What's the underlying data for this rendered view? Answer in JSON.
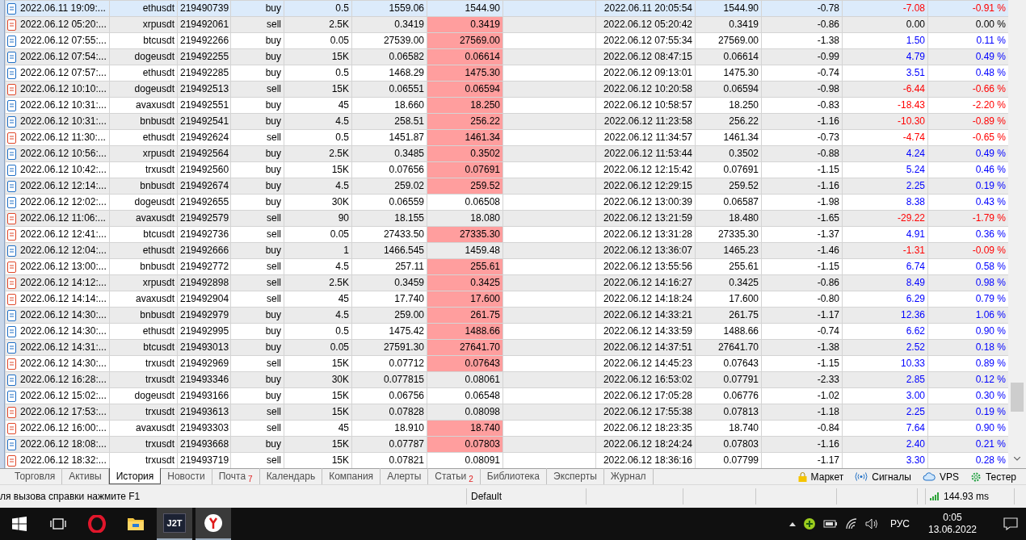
{
  "rows": [
    {
      "cells": [
        "2022.06.11 19:09:...",
        "ethusdt",
        "219490739",
        "buy",
        "0.5",
        "1559.06",
        "1544.90",
        "2022.06.11 20:05:54",
        "1544.90",
        "-0.78",
        "-7.08",
        "-0.91 %"
      ],
      "selected": true,
      "kind": "buy",
      "highlighted": false,
      "loss": true,
      "profit": false
    },
    {
      "cells": [
        "2022.06.12 05:20:...",
        "xrpusdt",
        "219492061",
        "sell",
        "2.5K",
        "0.3419",
        "0.3419",
        "2022.06.12 05:20:42",
        "0.3419",
        "-0.86",
        "0.00",
        "0.00 %"
      ],
      "selected": false,
      "kind": "sell",
      "highlighted": true,
      "loss": false,
      "profit": false
    },
    {
      "cells": [
        "2022.06.12 07:55:...",
        "btcusdt",
        "219492266",
        "buy",
        "0.05",
        "27539.00",
        "27569.00",
        "2022.06.12 07:55:34",
        "27569.00",
        "-1.38",
        "1.50",
        "0.11 %"
      ],
      "selected": false,
      "kind": "buy",
      "highlighted": true,
      "loss": false,
      "profit": true
    },
    {
      "cells": [
        "2022.06.12 07:54:...",
        "dogeusdt",
        "219492255",
        "buy",
        "15K",
        "0.06582",
        "0.06614",
        "2022.06.12 08:47:15",
        "0.06614",
        "-0.99",
        "4.79",
        "0.49 %"
      ],
      "selected": false,
      "kind": "buy",
      "highlighted": true,
      "loss": false,
      "profit": true
    },
    {
      "cells": [
        "2022.06.12 07:57:...",
        "ethusdt",
        "219492285",
        "buy",
        "0.5",
        "1468.29",
        "1475.30",
        "2022.06.12 09:13:01",
        "1475.30",
        "-0.74",
        "3.51",
        "0.48 %"
      ],
      "selected": false,
      "kind": "buy",
      "highlighted": true,
      "loss": false,
      "profit": true
    },
    {
      "cells": [
        "2022.06.12 10:10:...",
        "dogeusdt",
        "219492513",
        "sell",
        "15K",
        "0.06551",
        "0.06594",
        "2022.06.12 10:20:58",
        "0.06594",
        "-0.98",
        "-6.44",
        "-0.66 %"
      ],
      "selected": false,
      "kind": "sell",
      "highlighted": true,
      "loss": true,
      "profit": false
    },
    {
      "cells": [
        "2022.06.12 10:31:...",
        "avaxusdt",
        "219492551",
        "buy",
        "45",
        "18.660",
        "18.250",
        "2022.06.12 10:58:57",
        "18.250",
        "-0.83",
        "-18.43",
        "-2.20 %"
      ],
      "selected": false,
      "kind": "buy",
      "highlighted": true,
      "loss": true,
      "profit": false
    },
    {
      "cells": [
        "2022.06.12 10:31:...",
        "bnbusdt",
        "219492541",
        "buy",
        "4.5",
        "258.51",
        "256.22",
        "2022.06.12 11:23:58",
        "256.22",
        "-1.16",
        "-10.30",
        "-0.89 %"
      ],
      "selected": false,
      "kind": "buy",
      "highlighted": true,
      "loss": true,
      "profit": false
    },
    {
      "cells": [
        "2022.06.12 11:30:...",
        "ethusdt",
        "219492624",
        "sell",
        "0.5",
        "1451.87",
        "1461.34",
        "2022.06.12 11:34:57",
        "1461.34",
        "-0.73",
        "-4.74",
        "-0.65 %"
      ],
      "selected": false,
      "kind": "sell",
      "highlighted": true,
      "loss": true,
      "profit": false
    },
    {
      "cells": [
        "2022.06.12 10:56:...",
        "xrpusdt",
        "219492564",
        "buy",
        "2.5K",
        "0.3485",
        "0.3502",
        "2022.06.12 11:53:44",
        "0.3502",
        "-0.88",
        "4.24",
        "0.49 %"
      ],
      "selected": false,
      "kind": "buy",
      "highlighted": true,
      "loss": false,
      "profit": true
    },
    {
      "cells": [
        "2022.06.12 10:42:...",
        "trxusdt",
        "219492560",
        "buy",
        "15K",
        "0.07656",
        "0.07691",
        "2022.06.12 12:15:42",
        "0.07691",
        "-1.15",
        "5.24",
        "0.46 %"
      ],
      "selected": false,
      "kind": "buy",
      "highlighted": true,
      "loss": false,
      "profit": true
    },
    {
      "cells": [
        "2022.06.12 12:14:...",
        "bnbusdt",
        "219492674",
        "buy",
        "4.5",
        "259.02",
        "259.52",
        "2022.06.12 12:29:15",
        "259.52",
        "-1.16",
        "2.25",
        "0.19 %"
      ],
      "selected": false,
      "kind": "buy",
      "highlighted": true,
      "loss": false,
      "profit": true
    },
    {
      "cells": [
        "2022.06.12 12:02:...",
        "dogeusdt",
        "219492655",
        "buy",
        "30K",
        "0.06559",
        "0.06508",
        "2022.06.12 13:00:39",
        "0.06587",
        "-1.98",
        "8.38",
        "0.43 %"
      ],
      "selected": false,
      "kind": "buy",
      "highlighted": false,
      "loss": false,
      "profit": true
    },
    {
      "cells": [
        "2022.06.12 11:06:...",
        "avaxusdt",
        "219492579",
        "sell",
        "90",
        "18.155",
        "18.080",
        "2022.06.12 13:21:59",
        "18.480",
        "-1.65",
        "-29.22",
        "-1.79 %"
      ],
      "selected": false,
      "kind": "sell",
      "highlighted": false,
      "loss": true,
      "profit": false
    },
    {
      "cells": [
        "2022.06.12 12:41:...",
        "btcusdt",
        "219492736",
        "sell",
        "0.05",
        "27433.50",
        "27335.30",
        "2022.06.12 13:31:28",
        "27335.30",
        "-1.37",
        "4.91",
        "0.36 %"
      ],
      "selected": false,
      "kind": "sell",
      "highlighted": true,
      "loss": false,
      "profit": true
    },
    {
      "cells": [
        "2022.06.12 12:04:...",
        "ethusdt",
        "219492666",
        "buy",
        "1",
        "1466.545",
        "1459.48",
        "2022.06.12 13:36:07",
        "1465.23",
        "-1.46",
        "-1.31",
        "-0.09 %"
      ],
      "selected": false,
      "kind": "buy",
      "highlighted": false,
      "loss": true,
      "profit": false
    },
    {
      "cells": [
        "2022.06.12 13:00:...",
        "bnbusdt",
        "219492772",
        "sell",
        "4.5",
        "257.11",
        "255.61",
        "2022.06.12 13:55:56",
        "255.61",
        "-1.15",
        "6.74",
        "0.58 %"
      ],
      "selected": false,
      "kind": "sell",
      "highlighted": true,
      "loss": false,
      "profit": true
    },
    {
      "cells": [
        "2022.06.12 14:12:...",
        "xrpusdt",
        "219492898",
        "sell",
        "2.5K",
        "0.3459",
        "0.3425",
        "2022.06.12 14:16:27",
        "0.3425",
        "-0.86",
        "8.49",
        "0.98 %"
      ],
      "selected": false,
      "kind": "sell",
      "highlighted": true,
      "loss": false,
      "profit": true
    },
    {
      "cells": [
        "2022.06.12 14:14:...",
        "avaxusdt",
        "219492904",
        "sell",
        "45",
        "17.740",
        "17.600",
        "2022.06.12 14:18:24",
        "17.600",
        "-0.80",
        "6.29",
        "0.79 %"
      ],
      "selected": false,
      "kind": "sell",
      "highlighted": true,
      "loss": false,
      "profit": true
    },
    {
      "cells": [
        "2022.06.12 14:30:...",
        "bnbusdt",
        "219492979",
        "buy",
        "4.5",
        "259.00",
        "261.75",
        "2022.06.12 14:33:21",
        "261.75",
        "-1.17",
        "12.36",
        "1.06 %"
      ],
      "selected": false,
      "kind": "buy",
      "highlighted": true,
      "loss": false,
      "profit": true
    },
    {
      "cells": [
        "2022.06.12 14:30:...",
        "ethusdt",
        "219492995",
        "buy",
        "0.5",
        "1475.42",
        "1488.66",
        "2022.06.12 14:33:59",
        "1488.66",
        "-0.74",
        "6.62",
        "0.90 %"
      ],
      "selected": false,
      "kind": "buy",
      "highlighted": true,
      "loss": false,
      "profit": true
    },
    {
      "cells": [
        "2022.06.12 14:31:...",
        "btcusdt",
        "219493013",
        "buy",
        "0.05",
        "27591.30",
        "27641.70",
        "2022.06.12 14:37:51",
        "27641.70",
        "-1.38",
        "2.52",
        "0.18 %"
      ],
      "selected": false,
      "kind": "buy",
      "highlighted": true,
      "loss": false,
      "profit": true
    },
    {
      "cells": [
        "2022.06.12 14:30:...",
        "trxusdt",
        "219492969",
        "sell",
        "15K",
        "0.07712",
        "0.07643",
        "2022.06.12 14:45:23",
        "0.07643",
        "-1.15",
        "10.33",
        "0.89 %"
      ],
      "selected": false,
      "kind": "sell",
      "highlighted": true,
      "loss": false,
      "profit": true
    },
    {
      "cells": [
        "2022.06.12 16:28:...",
        "trxusdt",
        "219493346",
        "buy",
        "30K",
        "0.077815",
        "0.08061",
        "2022.06.12 16:53:02",
        "0.07791",
        "-2.33",
        "2.85",
        "0.12 %"
      ],
      "selected": false,
      "kind": "buy",
      "highlighted": false,
      "loss": false,
      "profit": true
    },
    {
      "cells": [
        "2022.06.12 15:02:...",
        "dogeusdt",
        "219493166",
        "buy",
        "15K",
        "0.06756",
        "0.06548",
        "2022.06.12 17:05:28",
        "0.06776",
        "-1.02",
        "3.00",
        "0.30 %"
      ],
      "selected": false,
      "kind": "buy",
      "highlighted": false,
      "loss": false,
      "profit": true
    },
    {
      "cells": [
        "2022.06.12 17:53:...",
        "trxusdt",
        "219493613",
        "sell",
        "15K",
        "0.07828",
        "0.08098",
        "2022.06.12 17:55:38",
        "0.07813",
        "-1.18",
        "2.25",
        "0.19 %"
      ],
      "selected": false,
      "kind": "sell",
      "highlighted": false,
      "loss": false,
      "profit": true
    },
    {
      "cells": [
        "2022.06.12 16:00:...",
        "avaxusdt",
        "219493303",
        "sell",
        "45",
        "18.910",
        "18.740",
        "2022.06.12 18:23:35",
        "18.740",
        "-0.84",
        "7.64",
        "0.90 %"
      ],
      "selected": false,
      "kind": "sell",
      "highlighted": true,
      "loss": false,
      "profit": true
    },
    {
      "cells": [
        "2022.06.12 18:08:...",
        "trxusdt",
        "219493668",
        "buy",
        "15K",
        "0.07787",
        "0.07803",
        "2022.06.12 18:24:24",
        "0.07803",
        "-1.16",
        "2.40",
        "0.21 %"
      ],
      "selected": false,
      "kind": "buy",
      "highlighted": true,
      "loss": false,
      "profit": true
    },
    {
      "cells": [
        "2022.06.12 18:32:...",
        "trxusdt",
        "219493719",
        "sell",
        "15K",
        "0.07821",
        "0.08091",
        "2022.06.12 18:36:16",
        "0.07799",
        "-1.17",
        "3.30",
        "0.28 %"
      ],
      "selected": false,
      "kind": "sell",
      "highlighted": false,
      "loss": false,
      "profit": true
    }
  ],
  "tabs": [
    {
      "label": "Торговля",
      "selected": false
    },
    {
      "label": "Активы",
      "selected": false
    },
    {
      "label": "История",
      "selected": true
    },
    {
      "label": "Новости",
      "selected": false
    },
    {
      "label": "Почта",
      "badge": "7",
      "selected": false
    },
    {
      "label": "Календарь",
      "selected": false
    },
    {
      "label": "Компания",
      "selected": false
    },
    {
      "label": "Алерты",
      "selected": false
    },
    {
      "label": "Статьи",
      "badge": "2",
      "selected": false
    },
    {
      "label": "Библиотека",
      "selected": false
    },
    {
      "label": "Эксперты",
      "selected": false
    },
    {
      "label": "Журнал",
      "selected": false
    }
  ],
  "tool_links": [
    {
      "kind": "market",
      "label": "Маркет"
    },
    {
      "kind": "signals",
      "label": "Сигналы"
    },
    {
      "kind": "vps",
      "label": "VPS"
    },
    {
      "kind": "tester",
      "label": "Тестер"
    }
  ],
  "status_bar": {
    "help": "ля вызова справки нажмите F1",
    "profile": "Default",
    "ping": "144.93 ms"
  },
  "taskbar": {
    "apps": [
      {
        "kind": "start",
        "open": false
      },
      {
        "kind": "task-view",
        "open": false
      },
      {
        "kind": "opera",
        "open": false
      },
      {
        "kind": "folder",
        "open": false
      },
      {
        "kind": "text-tile",
        "label": "J2T",
        "open": true
      },
      {
        "kind": "yandex",
        "open": true
      }
    ],
    "language": "РУС",
    "time": "0:05",
    "date": "13.06.2022"
  }
}
